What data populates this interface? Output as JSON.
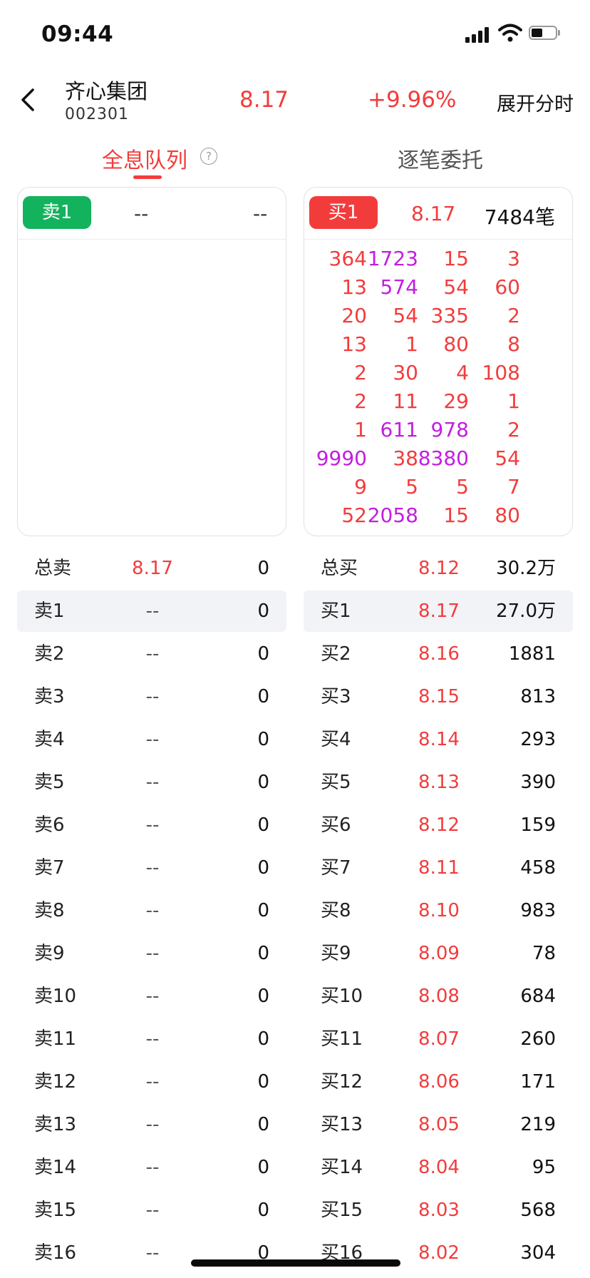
{
  "status_bar": {
    "time": "09:44"
  },
  "header": {
    "stock_name": "齐心集团",
    "stock_code": "002301",
    "price": "8.17",
    "change": "+9.96%",
    "expand_label": "展开分时"
  },
  "tabs": {
    "active": "全息队列",
    "help": "?",
    "other": "逐笔委托"
  },
  "sell_card": {
    "badge": "卖1",
    "price": "--",
    "count": "--"
  },
  "buy_card": {
    "badge": "买1",
    "price": "8.17",
    "count": "7484笔",
    "queue": [
      [
        "364",
        "1723",
        "15",
        "3"
      ],
      [
        "13",
        "574",
        "54",
        "60"
      ],
      [
        "20",
        "54",
        "335",
        "2"
      ],
      [
        "13",
        "1",
        "80",
        "8"
      ],
      [
        "2",
        "30",
        "4",
        "108"
      ],
      [
        "2",
        "11",
        "29",
        "1"
      ],
      [
        "1",
        "611",
        "978",
        "2"
      ],
      [
        "9990",
        "38",
        "8380",
        "54"
      ],
      [
        "9",
        "5",
        "5",
        "7"
      ],
      [
        "52",
        "2058",
        "15",
        "80"
      ]
    ],
    "highlight_color": "#c21ee0",
    "normal_color": "#f23c3c"
  },
  "sell_depth": [
    {
      "label": "总卖",
      "price": "8.17",
      "volume": "0"
    },
    {
      "label": "卖1",
      "price": "--",
      "volume": "0"
    },
    {
      "label": "卖2",
      "price": "--",
      "volume": "0"
    },
    {
      "label": "卖3",
      "price": "--",
      "volume": "0"
    },
    {
      "label": "卖4",
      "price": "--",
      "volume": "0"
    },
    {
      "label": "卖5",
      "price": "--",
      "volume": "0"
    },
    {
      "label": "卖6",
      "price": "--",
      "volume": "0"
    },
    {
      "label": "卖7",
      "price": "--",
      "volume": "0"
    },
    {
      "label": "卖8",
      "price": "--",
      "volume": "0"
    },
    {
      "label": "卖9",
      "price": "--",
      "volume": "0"
    },
    {
      "label": "卖10",
      "price": "--",
      "volume": "0"
    },
    {
      "label": "卖11",
      "price": "--",
      "volume": "0"
    },
    {
      "label": "卖12",
      "price": "--",
      "volume": "0"
    },
    {
      "label": "卖13",
      "price": "--",
      "volume": "0"
    },
    {
      "label": "卖14",
      "price": "--",
      "volume": "0"
    },
    {
      "label": "卖15",
      "price": "--",
      "volume": "0"
    },
    {
      "label": "卖16",
      "price": "--",
      "volume": "0"
    }
  ],
  "buy_depth": [
    {
      "label": "总买",
      "price": "8.12",
      "volume": "30.2万"
    },
    {
      "label": "买1",
      "price": "8.17",
      "volume": "27.0万"
    },
    {
      "label": "买2",
      "price": "8.16",
      "volume": "1881"
    },
    {
      "label": "买3",
      "price": "8.15",
      "volume": "813"
    },
    {
      "label": "买4",
      "price": "8.14",
      "volume": "293"
    },
    {
      "label": "买5",
      "price": "8.13",
      "volume": "390"
    },
    {
      "label": "买6",
      "price": "8.12",
      "volume": "159"
    },
    {
      "label": "买7",
      "price": "8.11",
      "volume": "458"
    },
    {
      "label": "买8",
      "price": "8.10",
      "volume": "983"
    },
    {
      "label": "买9",
      "price": "8.09",
      "volume": "78"
    },
    {
      "label": "买10",
      "price": "8.08",
      "volume": "684"
    },
    {
      "label": "买11",
      "price": "8.07",
      "volume": "260"
    },
    {
      "label": "买12",
      "price": "8.06",
      "volume": "171"
    },
    {
      "label": "买13",
      "price": "8.05",
      "volume": "219"
    },
    {
      "label": "买14",
      "price": "8.04",
      "volume": "95"
    },
    {
      "label": "买15",
      "price": "8.03",
      "volume": "568"
    },
    {
      "label": "买16",
      "price": "8.02",
      "volume": "304"
    }
  ],
  "colors": {
    "red": "#f23c3c",
    "green": "#13b25d",
    "purple": "#c21ee0"
  }
}
